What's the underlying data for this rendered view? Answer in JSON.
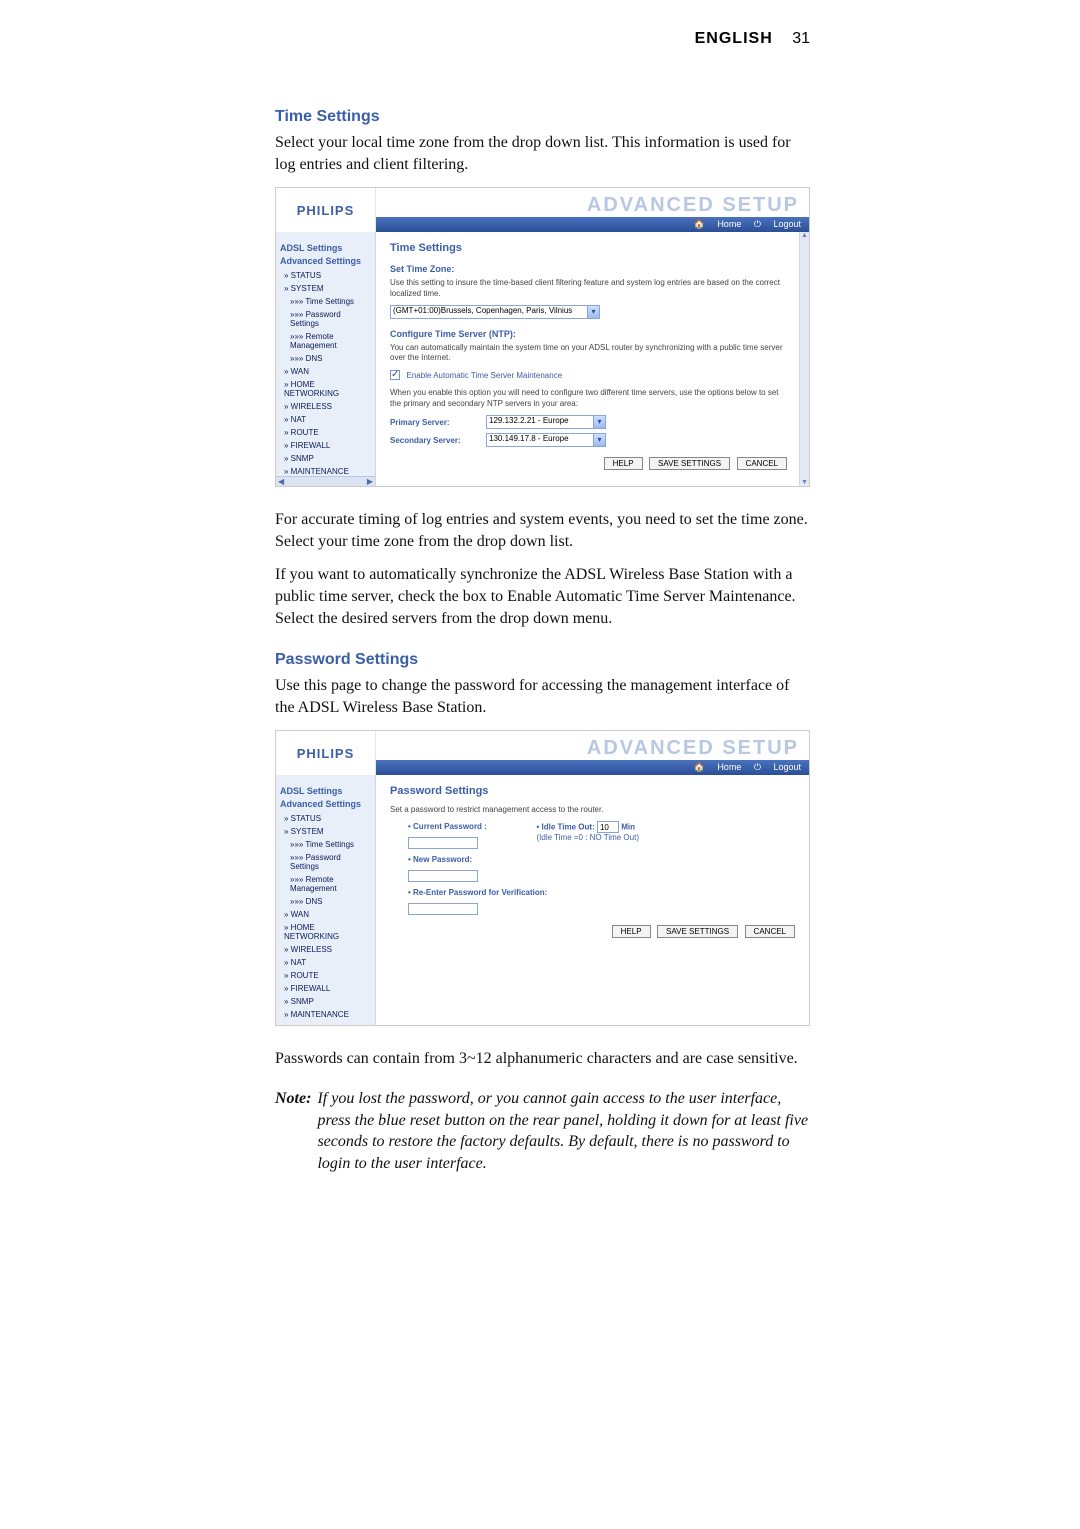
{
  "header": {
    "lang": "ENGLISH",
    "page_number": "31"
  },
  "section1": {
    "heading": "Time Settings",
    "intro": "Select your local time zone from the drop down list. This information is used for log entries and client filtering.",
    "para2": "For accurate timing of log entries and system events, you need to set the time zone. Select your time zone from the drop down list.",
    "para3": "If you want to automatically synchronize the ADSL Wireless Base Station with a public time server, check the box to Enable Automatic Time Server Maintenance. Select the desired servers from the drop down menu."
  },
  "section2": {
    "heading": "Password Settings",
    "intro": "Use this page to change the password for accessing the management interface of the ADSL Wireless Base Station.",
    "para2": "Passwords can contain from 3~12 alphanumeric characters and are case sensitive.",
    "note_label": "Note:",
    "note_body": "If you lost the password, or you cannot gain access to the user interface, press the blue reset button on the rear panel, holding it down for at least five seconds to restore the factory defaults. By default, there is no password to login to the user interface."
  },
  "router_common": {
    "brand": "PHILIPS",
    "banner": "ADVANCED SETUP",
    "home": "Home",
    "logout": "Logout",
    "nav_cat1": "ADSL Settings",
    "nav_cat2": "Advanced Settings",
    "nav_items": {
      "status": "» STATUS",
      "system": "» SYSTEM",
      "time_sub": "»»» Time Settings",
      "pw_sub": "»»» Password Settings",
      "remote_sub": "»»» Remote Management",
      "dns_sub": "»»» DNS",
      "wan": "» WAN",
      "home_net": "» HOME NETWORKING",
      "wireless": "» WIRELESS",
      "nat": "» NAT",
      "route": "» ROUTE",
      "firewall": "» FIREWALL",
      "snmp": "» SNMP",
      "maint": "» MAINTENANCE"
    },
    "buttons": {
      "help": "HELP",
      "save": "SAVE SETTINGS",
      "cancel": "CANCEL"
    }
  },
  "shot_time": {
    "heading": "Time Settings",
    "sub1": "Set Time Zone:",
    "text1": "Use this setting to insure the time-based client filtering feature and system log entries are based on the correct localized time.",
    "tz_value": "(GMT+01:00)Brussels, Copenhagen, Paris, Vilnius",
    "sub2": "Configure Time Server (NTP):",
    "text2": "You can automatically maintain the system time on your ADSL router by synchronizing with a public time server over the Internet.",
    "checkbox": "Enable Automatic Time Server Maintenance",
    "text3": "When you enable this option you will need to configure two different time servers, use the options below to set the primary and secondary NTP servers in your area:",
    "primary_label": "Primary Server:",
    "primary_value": "129.132.2.21 - Europe",
    "secondary_label": "Secondary Server:",
    "secondary_value": "130.149.17.8 - Europe"
  },
  "shot_pw": {
    "heading": "Password Settings",
    "text1": "Set a password to restrict management access to the router.",
    "current": "Current Password :",
    "new": "New Password:",
    "re": "Re-Enter Password for Verification:",
    "idle_label": "Idle Time Out:",
    "idle_value": "10",
    "idle_unit": "Min",
    "idle_hint": "(Idle Time =0 : NO Time Out)"
  }
}
